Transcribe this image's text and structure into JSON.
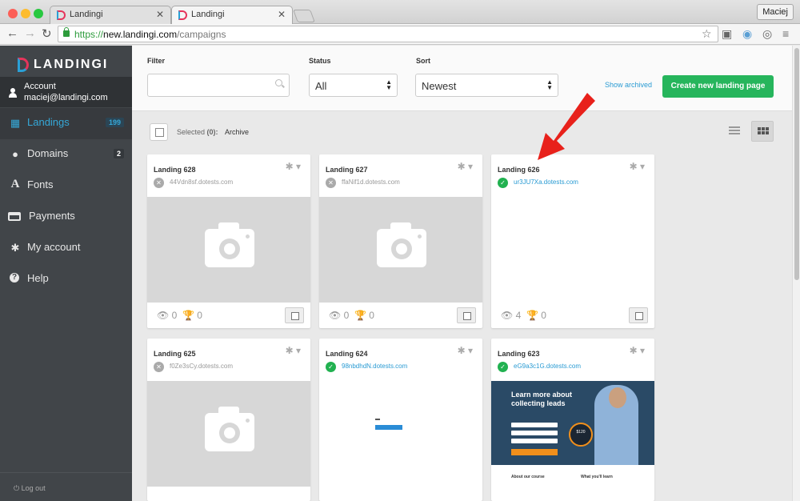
{
  "browser": {
    "tabs": [
      {
        "title": "Landingi"
      },
      {
        "title": "Landingi"
      }
    ],
    "url_scheme": "https://",
    "url_host": "new.landingi.com",
    "url_path": "/campaigns",
    "profile": "Maciej"
  },
  "sidebar": {
    "logo_text": "LANDINGI",
    "account_label": "Account",
    "account_email": "maciej@landingi.com",
    "items": [
      {
        "label": "Landings",
        "badge": "199",
        "icon": "grid-icon"
      },
      {
        "label": "Domains",
        "badge": "2",
        "icon": "globe-icon"
      },
      {
        "label": "Fonts",
        "icon": "font-icon"
      },
      {
        "label": "Payments",
        "icon": "credit-card-icon"
      },
      {
        "label": "My account",
        "icon": "gear-icon"
      },
      {
        "label": "Help",
        "icon": "question-icon"
      }
    ],
    "logout": "Log out"
  },
  "filters": {
    "filter_label": "Filter",
    "filter_value": "",
    "status_label": "Status",
    "status_value": "All",
    "sort_label": "Sort",
    "sort_value": "Newest",
    "show_archived": "Show archived",
    "create_button": "Create new landing page"
  },
  "selection": {
    "selected_text": "Selected",
    "selected_count": "(0):",
    "archive": "Archive"
  },
  "cards": [
    {
      "title": "Landing 628",
      "domain": "44Vdn8sf.dotests.com",
      "published": false,
      "views": "0",
      "conversions": "0"
    },
    {
      "title": "Landing 627",
      "domain": "ffaNif1d.dotests.com",
      "published": false,
      "views": "0",
      "conversions": "0"
    },
    {
      "title": "Landing 626",
      "domain": "ur3JU7Xa.dotests.com",
      "published": true,
      "views": "4",
      "conversions": "0"
    },
    {
      "title": "Landing 625",
      "domain": "f0Ze3sCy.dotests.com",
      "published": false
    },
    {
      "title": "Landing 624",
      "domain": "98nbdhdN.dotests.com",
      "published": true
    },
    {
      "title": "Landing 623",
      "domain": "eG9a3c1G.dotests.com",
      "published": true
    }
  ],
  "promo": {
    "headline_1": "Learn more about",
    "headline_2": "collecting leads",
    "price": "$120",
    "about": "About our course",
    "learn": "What you'll learn"
  },
  "colors": {
    "accent": "#2a9bd3",
    "create": "#26b55c",
    "arrow": "#e8211b"
  }
}
